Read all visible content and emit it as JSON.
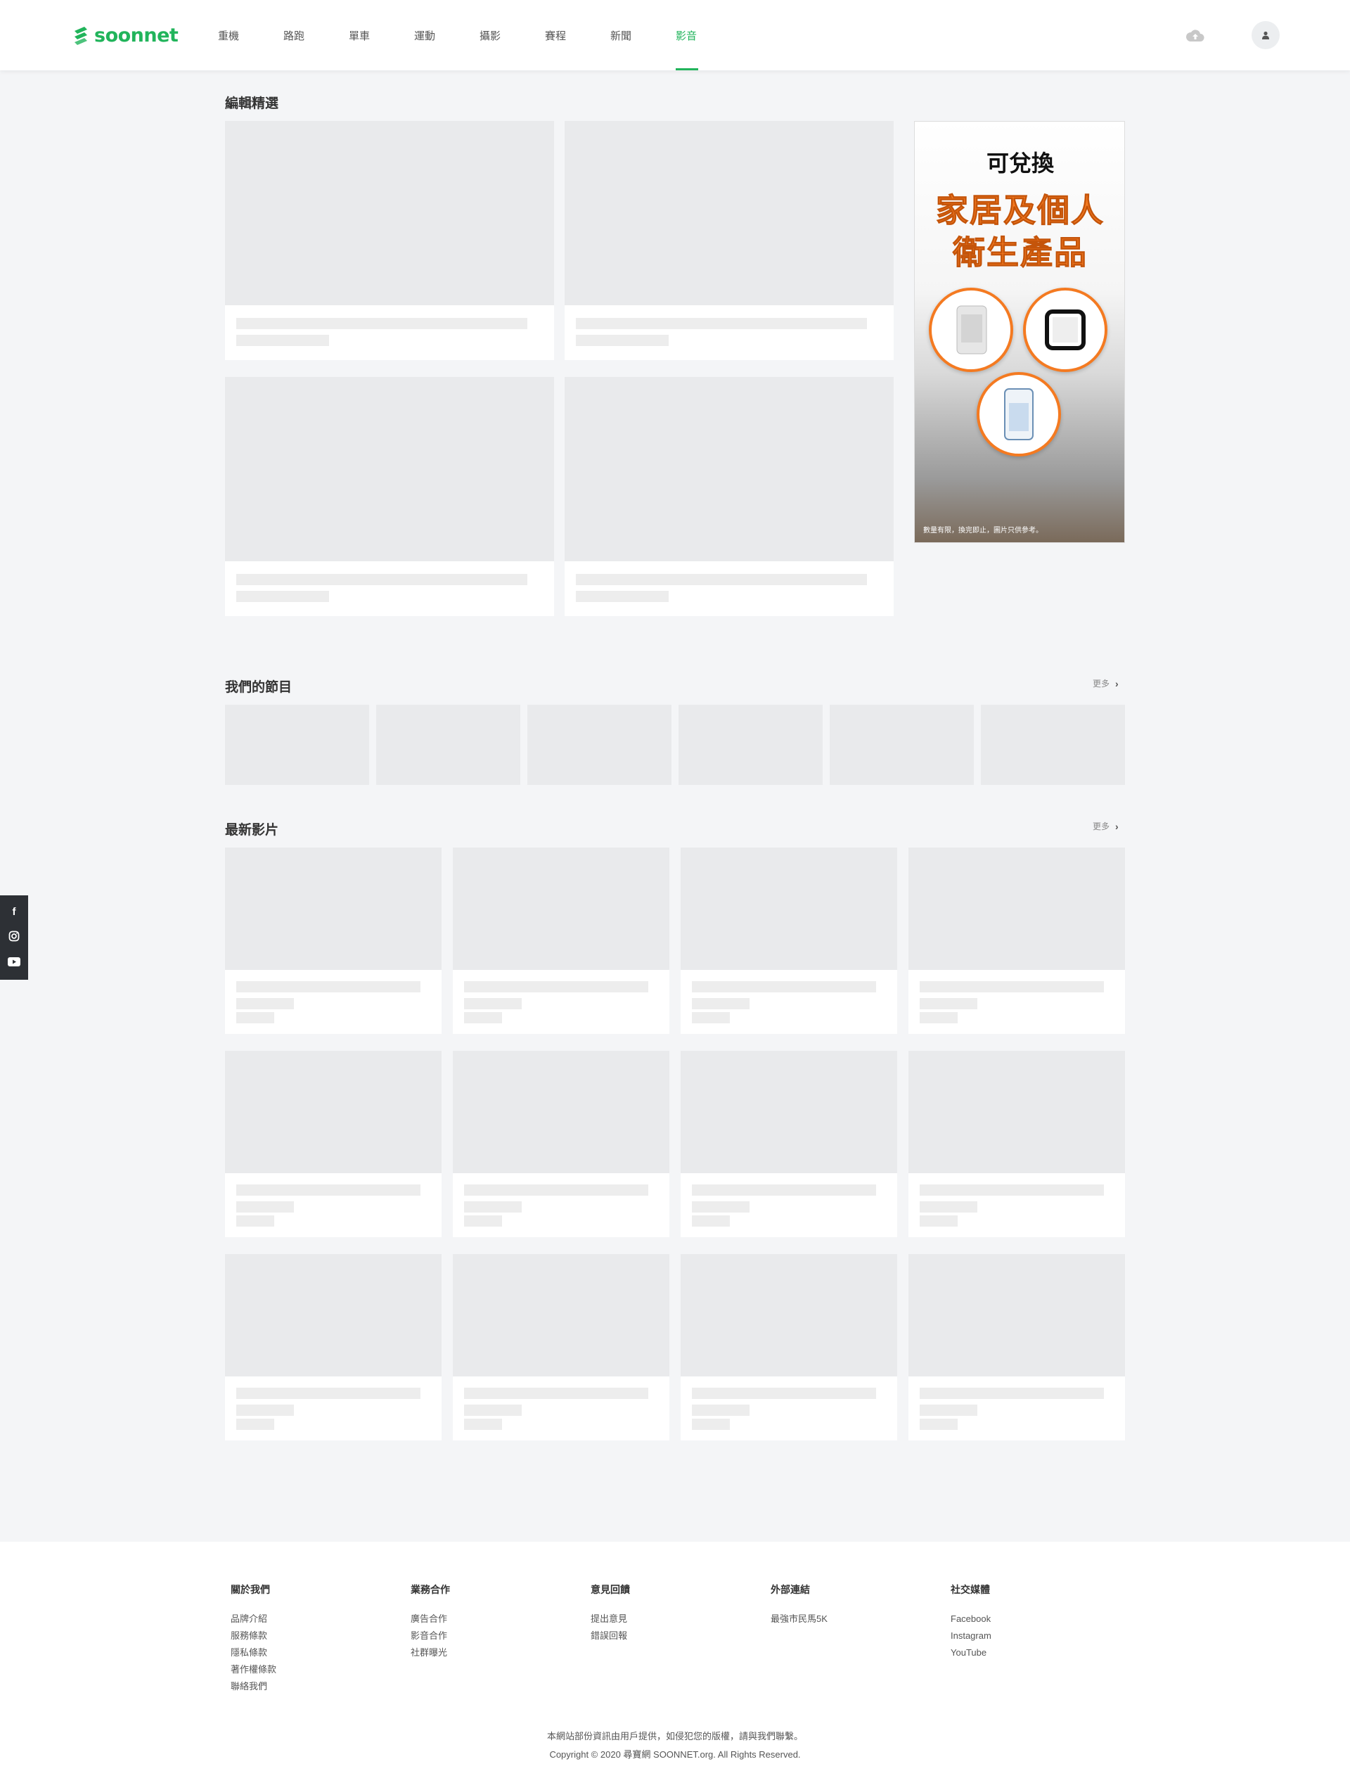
{
  "brand": {
    "name": "soonnet",
    "color": "#21b45b"
  },
  "nav": {
    "items": [
      "重機",
      "路跑",
      "單車",
      "運動",
      "攝影",
      "賽程",
      "新聞",
      "影音"
    ],
    "active_index": 7
  },
  "header_icons": {
    "upload": "cloud-upload-icon",
    "user": "user-icon"
  },
  "sections": {
    "featured": {
      "title": "編輯精選"
    },
    "programs": {
      "title": "我們的節目",
      "more": "更多"
    },
    "latest": {
      "title": "最新影片",
      "more": "更多"
    }
  },
  "ad": {
    "line1": "可兌換",
    "line2": "家居及個人",
    "line3": "衛生產品",
    "disclaimer": "數量有限，換完即止，圖片只供參考。"
  },
  "social_sidebar": [
    "facebook-icon",
    "instagram-icon",
    "youtube-icon"
  ],
  "footer": {
    "columns": [
      {
        "title": "關於我們",
        "links": [
          "品牌介紹",
          "服務條款",
          "隱私條款",
          "著作權條款",
          "聯絡我們"
        ]
      },
      {
        "title": "業務合作",
        "links": [
          "廣告合作",
          "影音合作",
          "社群曝光"
        ]
      },
      {
        "title": "意見回饋",
        "links": [
          "提出意見",
          "錯誤回報"
        ]
      },
      {
        "title": "外部連結",
        "links": [
          "最強市民馬5K"
        ]
      },
      {
        "title": "社交媒體",
        "links": [
          "Facebook",
          "Instagram",
          "YouTube"
        ]
      }
    ],
    "notice": "本網站部份資訊由用戶提供，如侵犯您的版權，請與我們聯繫。",
    "copyright": "Copyright © 2020 尋寶網 SOONNET.org. All Rights Reserved."
  }
}
